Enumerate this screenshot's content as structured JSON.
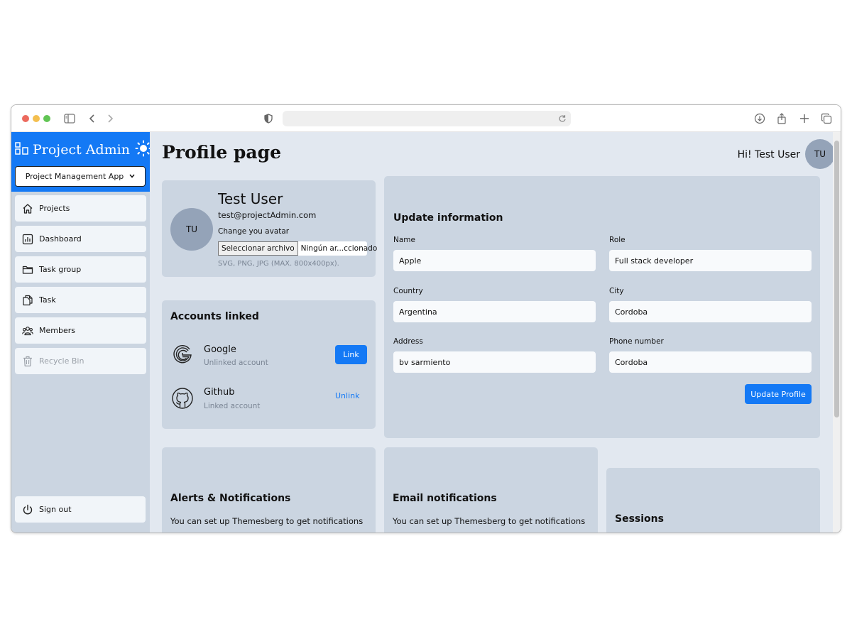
{
  "app": {
    "brand": "Project Admin",
    "project_select": "Project Management App"
  },
  "sidebar": {
    "items": [
      {
        "label": "Projects",
        "icon": "home-icon"
      },
      {
        "label": "Dashboard",
        "icon": "chart-icon"
      },
      {
        "label": "Task group",
        "icon": "folder-icon"
      },
      {
        "label": "Task",
        "icon": "documents-icon"
      },
      {
        "label": "Members",
        "icon": "users-icon"
      },
      {
        "label": "Recycle Bin",
        "icon": "trash-icon",
        "disabled": true
      }
    ],
    "signout": "Sign out"
  },
  "header": {
    "title": "Profile page",
    "greeting": "Hi! Test User",
    "avatar_initials": "TU"
  },
  "profile": {
    "avatar_initials": "TU",
    "name": "Test User",
    "email": "test@projectAdmin.com",
    "change_avatar": "Change you avatar",
    "file_button": "Seleccionar archivo",
    "file_name": "Ningún ar...ccionado",
    "file_hint": "SVG, PNG, JPG (MAX. 800x400px)."
  },
  "accounts": {
    "title": "Accounts linked",
    "items": [
      {
        "name": "Google",
        "status": "Unlinked account",
        "action": "Link"
      },
      {
        "name": "Github",
        "status": "Linked account",
        "action": "Unlink"
      }
    ]
  },
  "update": {
    "title": "Update information",
    "fields": {
      "name": {
        "label": "Name",
        "value": "Apple"
      },
      "role": {
        "label": "Role",
        "value": "Full stack developer"
      },
      "country": {
        "label": "Country",
        "value": "Argentina"
      },
      "city": {
        "label": "City",
        "value": "Cordoba"
      },
      "address": {
        "label": "Address",
        "value": "bv sarmiento"
      },
      "phone": {
        "label": "Phone number",
        "value": "Cordoba"
      }
    },
    "button": "Update Profile"
  },
  "alerts": {
    "title": "Alerts & Notifications",
    "text": "You can set up Themesberg to get notifications"
  },
  "email": {
    "title": "Email notifications",
    "text": "You can set up Themesberg to get notifications"
  },
  "sessions": {
    "title": "Sessions"
  },
  "colors": {
    "accent": "#1479f5",
    "sidebar_bg": "#cbd5e1",
    "main_bg": "#e2e8f0",
    "card_bg": "#cbd5e1",
    "avatar_bg": "#94a3b8"
  }
}
